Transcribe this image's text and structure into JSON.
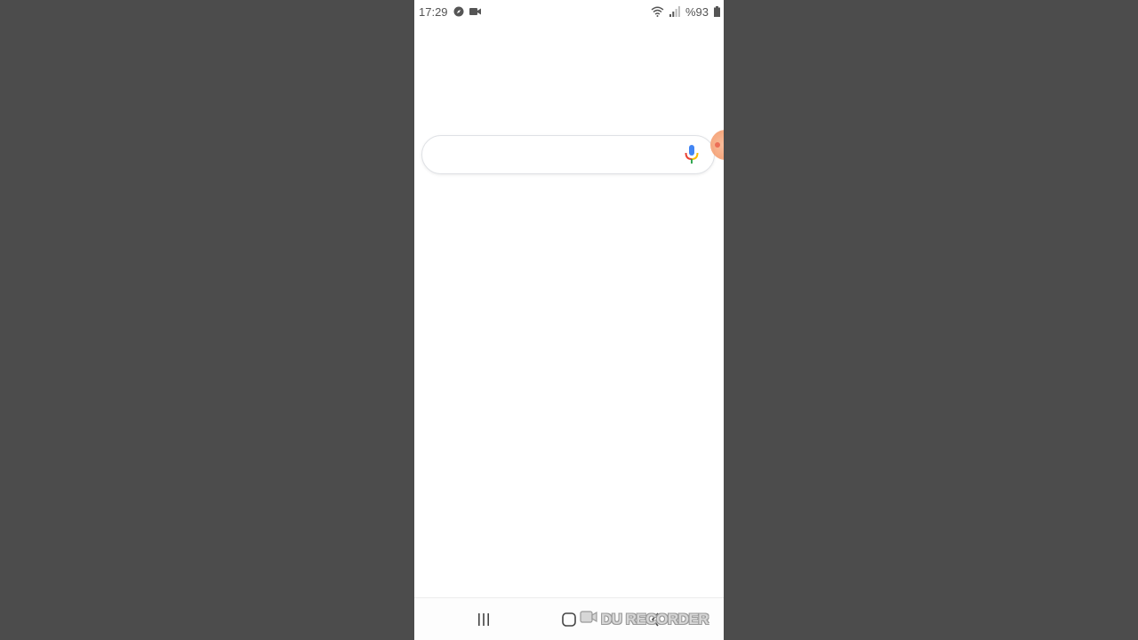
{
  "status_bar": {
    "time": "17:29",
    "battery": "%93",
    "icons": [
      "compass-icon",
      "video-camera-icon",
      "wifi-icon",
      "signal-icon",
      "battery-icon"
    ]
  },
  "search": {
    "value": "",
    "placeholder": "",
    "mic_icon": "microphone-icon"
  },
  "nav_bar": {
    "items": [
      "recents-icon",
      "home-icon",
      "back-icon"
    ]
  },
  "watermark": {
    "text": "DU RECORDER"
  },
  "colors": {
    "background": "#4c4c4c",
    "screen": "#ffffff",
    "mic_blue": "#4285f4",
    "mic_red": "#ea4335",
    "mic_yellow": "#fbbc05",
    "mic_green": "#34a853",
    "recorder_orange": "#f59a6a"
  }
}
